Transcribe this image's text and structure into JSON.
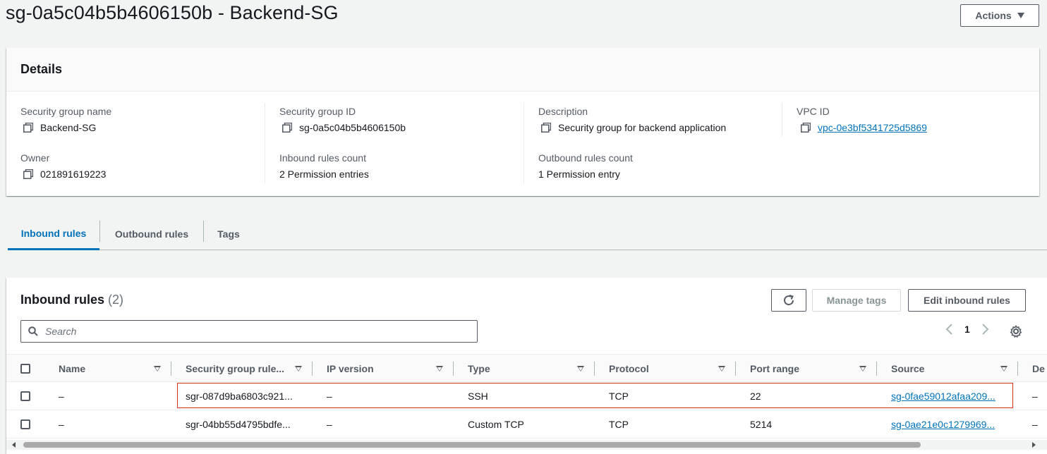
{
  "page": {
    "title": "sg-0a5c04b5b4606150b - Backend-SG",
    "actions_label": "Actions"
  },
  "details": {
    "header": "Details",
    "fields": [
      {
        "label": "Security group name",
        "value": "Backend-SG",
        "copy": true,
        "link": false
      },
      {
        "label": "Security group ID",
        "value": "sg-0a5c04b5b4606150b",
        "copy": true,
        "link": false
      },
      {
        "label": "Description",
        "value": "Security group for backend application",
        "copy": true,
        "link": false
      },
      {
        "label": "VPC ID",
        "value": "vpc-0e3bf5341725d5869",
        "copy": true,
        "link": true
      },
      {
        "label": "Owner",
        "value": "021891619223",
        "copy": true,
        "link": false
      },
      {
        "label": "Inbound rules count",
        "value": "2 Permission entries",
        "copy": false,
        "link": false
      },
      {
        "label": "Outbound rules count",
        "value": "1 Permission entry",
        "copy": false,
        "link": false
      }
    ]
  },
  "tabs": [
    {
      "label": "Inbound rules",
      "active": true
    },
    {
      "label": "Outbound rules",
      "active": false
    },
    {
      "label": "Tags",
      "active": false
    }
  ],
  "inbound": {
    "title": "Inbound rules",
    "count": "(2)",
    "refresh_icon": "refresh-icon",
    "manage_tags_label": "Manage tags",
    "edit_label": "Edit inbound rules",
    "search_placeholder": "Search",
    "page_number": "1",
    "columns": [
      "Name",
      "Security group rule...",
      "IP version",
      "Type",
      "Protocol",
      "Port range",
      "Source",
      "De"
    ],
    "rows": [
      {
        "name": "–",
        "rule_id": "sgr-087d9ba6803c921...",
        "ip_version": "–",
        "type": "SSH",
        "protocol": "TCP",
        "port_range": "22",
        "source": "sg-0fae59012afaa209...",
        "extra": "–"
      },
      {
        "name": "–",
        "rule_id": "sgr-04bb55d4795bdfe...",
        "ip_version": "–",
        "type": "Custom TCP",
        "protocol": "TCP",
        "port_range": "5214",
        "source": "sg-0ae21e0c1279969...",
        "extra": "–"
      }
    ]
  },
  "colors": {
    "accent": "#0073bb",
    "highlight": "#d13212",
    "background": "#f2f3f3"
  }
}
